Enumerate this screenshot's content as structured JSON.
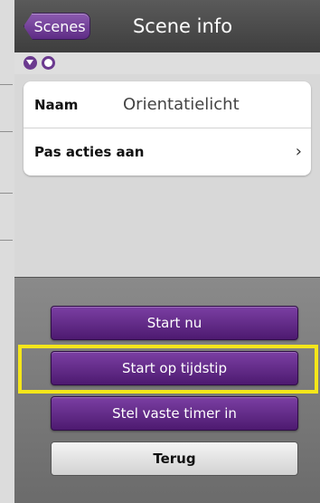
{
  "header": {
    "back_label": "Scenes",
    "title": "Scene info"
  },
  "toolbar": {
    "icons": [
      "filter-icon",
      "ring-icon"
    ]
  },
  "info_card": {
    "name_label": "Naam",
    "name_value": "Orientatielicht",
    "edit_actions_label": "Pas acties aan",
    "chevron": "›"
  },
  "actions": {
    "start_now": "Start nu",
    "start_at_time": "Start op tijdstip",
    "set_fixed_timer": "Stel vaste timer in",
    "back": "Terug"
  },
  "colors": {
    "accent_purple": "#5e2c85",
    "highlight": "#f5e61a"
  }
}
